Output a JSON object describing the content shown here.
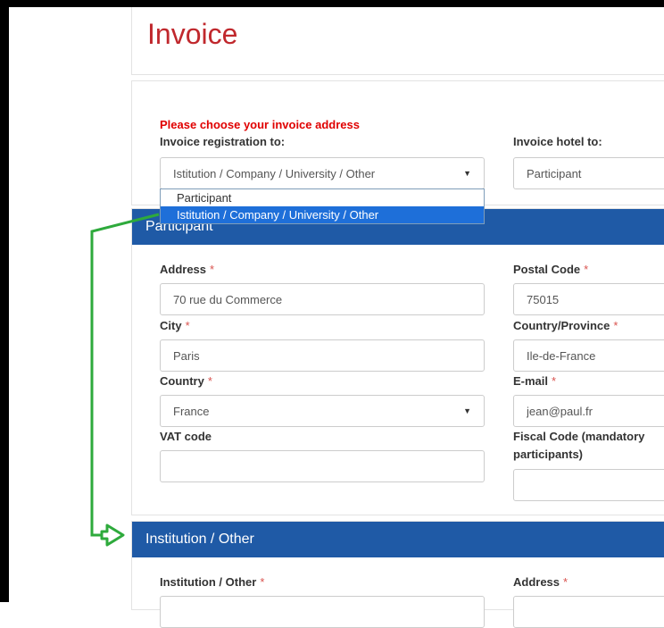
{
  "title": "Invoice",
  "address_section": {
    "warning": "Please choose your invoice address",
    "registration_label": "Invoice registration to:",
    "registration_value": "Istitution / Company / University / Other",
    "hotel_label": "Invoice hotel to:",
    "hotel_value": "Participant",
    "dropdown_options": [
      "Participant",
      "Istitution / Company / University / Other"
    ]
  },
  "participant": {
    "header": "Participant",
    "address_label": "Address",
    "address_value": "70 rue du Commerce",
    "postal_label": "Postal Code",
    "postal_value": "75015",
    "city_label": "City",
    "city_value": "Paris",
    "province_label": "Country/Province",
    "province_value": "Ile-de-France",
    "country_label": "Country",
    "country_value": "France",
    "email_label": "E-mail",
    "email_value": "jean@paul.fr",
    "vat_label": "VAT code",
    "vat_value": "",
    "fiscal_label_line1": "Fiscal Code (mandatory",
    "fiscal_label_line2": "participants)",
    "fiscal_value": ""
  },
  "institution": {
    "header": "Institution / Other",
    "name_label": "Institution / Other",
    "address_label": "Address"
  },
  "required_marker": "*",
  "colors": {
    "header_bar": "#1f5aa6",
    "title": "#c0282d",
    "warning": "#e00000",
    "annotation_arrow": "#2eaa3c"
  }
}
